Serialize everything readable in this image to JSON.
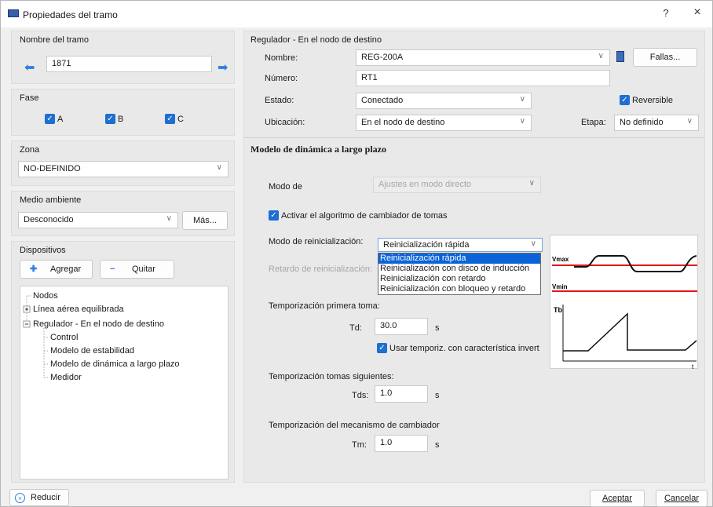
{
  "window": {
    "title": "Propiedades del tramo",
    "help": "?",
    "close": "×"
  },
  "left": {
    "segment_name_label": "Nombre del tramo",
    "segment_name": "1871",
    "phase_label": "Fase",
    "phases": [
      {
        "label": "A",
        "checked": true
      },
      {
        "label": "B",
        "checked": true
      },
      {
        "label": "C",
        "checked": true
      }
    ],
    "zone_label": "Zona",
    "zone_value": "NO-DEFINIDO",
    "env_label": "Medio ambiente",
    "env_value": "Desconocido",
    "env_more": "Más...",
    "devices_label": "Dispositivos",
    "add_label": "Agregar",
    "remove_label": "Quitar",
    "tree": [
      "Nodos",
      "Línea aérea equilibrada",
      "Regulador - En el nodo de destino",
      "Control",
      "Modelo de estabilidad",
      "Modelo de dinámica a largo plazo",
      "Medidor"
    ]
  },
  "regulator": {
    "section_title": "Regulador - En el nodo de destino",
    "name_label": "Nombre:",
    "name_value": "REG-200A",
    "faults_button": "Fallas...",
    "number_label": "Número:",
    "number_value": "RT1",
    "state_label": "Estado:",
    "state_value": "Conectado",
    "reversible_label": "Reversible",
    "location_label": "Ubicación:",
    "location_value": "En el nodo de destino",
    "stage_label": "Etapa:",
    "stage_value": "No definido"
  },
  "dynamics": {
    "title": "Modelo de dinámica a largo plazo",
    "mode_label": "Modo de",
    "mode_value": "Ajustes en modo directo",
    "activate_label": "Activar el algoritmo de cambiador de tomas",
    "reset_mode_label": "Modo de reinicialización:",
    "reset_mode_value": "Reinicialización rápida",
    "reset_options": [
      "Reinicialización rápida",
      "Reinicialización con disco de inducción",
      "Reinicialización con retardo",
      "Reinicialización con bloqueo y retardo"
    ],
    "reset_delay_label": "Retardo de reinicialización:",
    "first_tap_label": "Temporización primera toma:",
    "td_label": "Td:",
    "td_value": "30.0",
    "td_unit": "s",
    "inverse_label": "Usar temporiz. con característica invert",
    "next_taps_label": "Temporización tomas siguientes:",
    "tds_label": "Tds:",
    "tds_value": "1.0",
    "tds_unit": "s",
    "mech_label": "Temporización del mecanismo de cambiador",
    "tm_label": "Tm:",
    "tm_value": "1.0",
    "tm_unit": "s",
    "graph": {
      "vmax": "Vmax",
      "vmin": "Vmin",
      "tb": "Tb",
      "t": "t"
    }
  },
  "footer": {
    "reduce": "Reducir",
    "accept": "Aceptar",
    "cancel": "Cancelar"
  },
  "colors": {
    "accent": "#1f6fd0",
    "highlight": "#0a64d8",
    "threshold": "#e0191a"
  }
}
